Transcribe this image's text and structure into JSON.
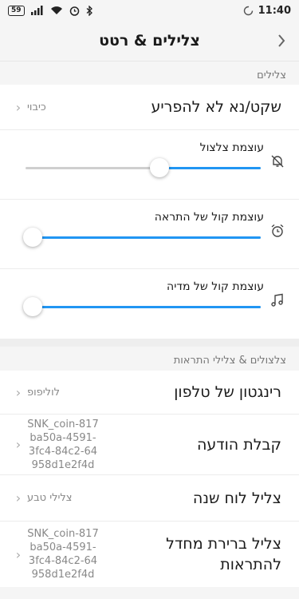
{
  "status": {
    "battery": "59",
    "time": "11:40"
  },
  "header": {
    "title": "צלילים & רטט"
  },
  "sections": {
    "sounds_label": "צלילים",
    "notifications_label": "צלצולים & צלילי התראות"
  },
  "dnd": {
    "label": "שקט/נא לא להפריע",
    "value": "כיבוי"
  },
  "sliders": [
    {
      "label": "עוצמת צלצול",
      "icon": "bell-off-icon",
      "level": 0.57
    },
    {
      "label": "עוצמת קול של התראה",
      "icon": "alarm-clock-icon",
      "level": 0.03
    },
    {
      "label": "עוצמת קול של מדיה",
      "icon": "music-note-icon",
      "level": 0.03
    }
  ],
  "tones": [
    {
      "label": "רינגטון של טלפון",
      "value": "לוליפופ"
    },
    {
      "label": "קבלת הודעה",
      "value": "SNK_coin-817ba50a-4591-3fc4-84c2-64958d1e2f4d"
    },
    {
      "label": "צליל לוח שנה",
      "value": "צלילי טבע"
    },
    {
      "label": "צליל ברירת מחדל להתראות",
      "value": "SNK_coin-817ba50a-4591-3fc4-84c2-64958d1e2f4d"
    }
  ],
  "colors": {
    "accent": "#2196f3",
    "track": "#cfcfcf",
    "background": "#f5f5f5"
  }
}
